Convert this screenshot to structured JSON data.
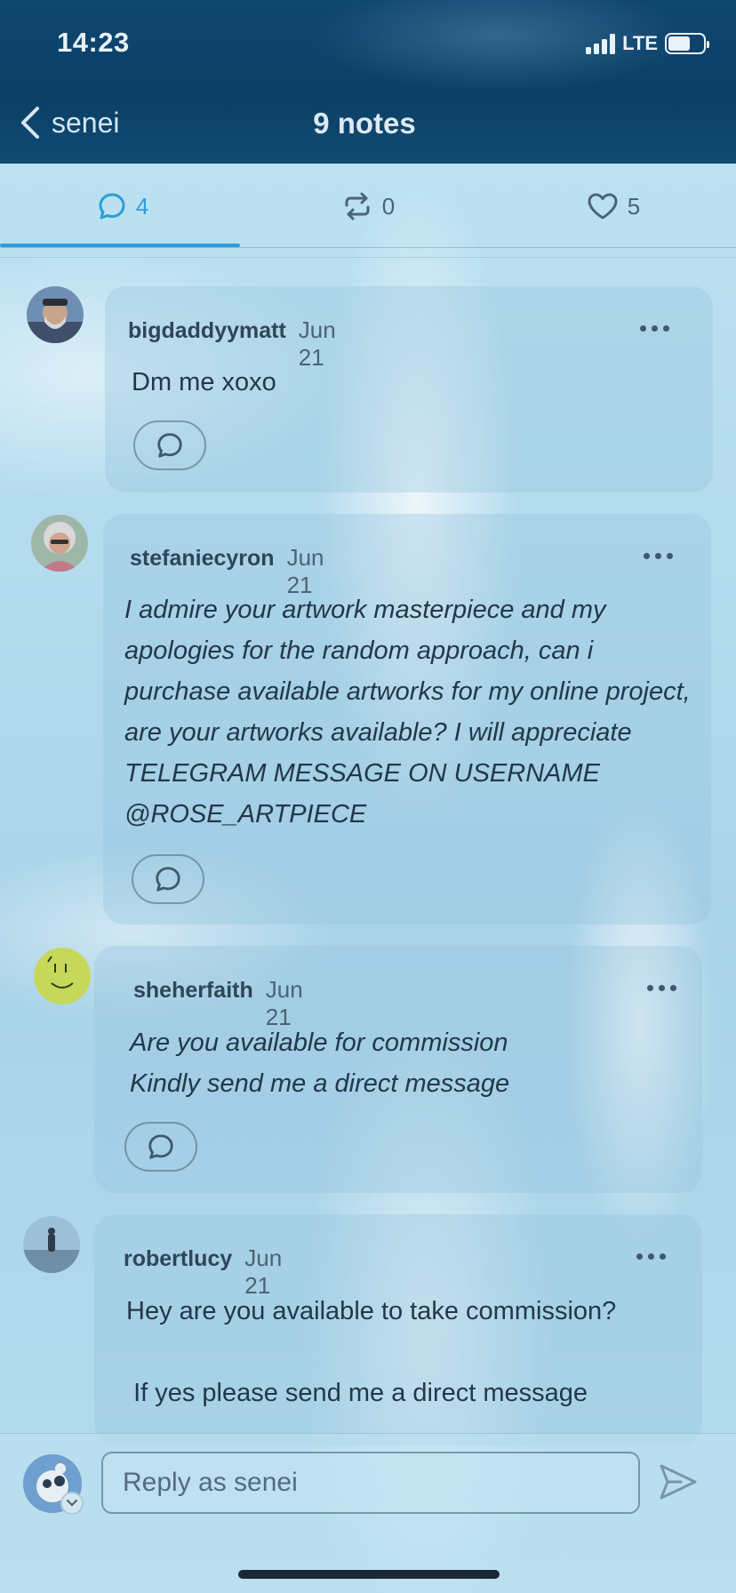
{
  "status_bar": {
    "time": "14:23",
    "network": "LTE"
  },
  "header": {
    "back_label": "senei",
    "title": "9 notes"
  },
  "tabs": [
    {
      "icon": "comment-icon",
      "count": "4",
      "active": true
    },
    {
      "icon": "reblog-icon",
      "count": "0",
      "active": false
    },
    {
      "icon": "heart-icon",
      "count": "5",
      "active": false
    }
  ],
  "notes": [
    {
      "username": "bigdaddyymatt",
      "date": "Jun 21",
      "text": "Dm me xoxo"
    },
    {
      "username": "stefaniecyron",
      "date": "Jun 21",
      "text": "I admire your artwork masterpiece and my apologies for the random approach, can i purchase available artworks for my online project, are your artworks available? I will appreciate TELEGRAM MESSAGE ON USERNAME @ROSE_ARTPIECE"
    },
    {
      "username": "sheherfaith",
      "date": "Jun 21",
      "text": "Are you available for commission\nKindly send me a direct message"
    },
    {
      "username": "robertlucy",
      "date": "Jun 21",
      "text": "Hey are you available to take commission?\n\n If yes please send me a direct message"
    }
  ],
  "compose": {
    "placeholder": "Reply as senei"
  },
  "colors": {
    "accent": "#2a9fd8",
    "header_bg": "#0c4066"
  }
}
